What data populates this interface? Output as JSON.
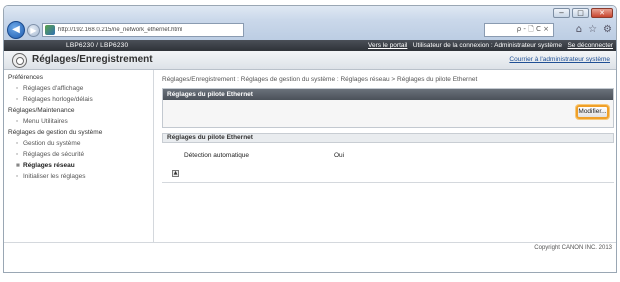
{
  "browser": {
    "url": "http://192.168.0.215/ne_network_ethernet.html",
    "search_hint": "ρ - 🗋 C ×",
    "window_controls": [
      "−",
      "□",
      "✕"
    ]
  },
  "topbar": {
    "model": "LBP6230 / LBP6230",
    "portal_link": "Vers le portail",
    "user_text": "Utilisateur de la connexion : Administrateur système",
    "logout_link": "Se déconnecter"
  },
  "header": {
    "title": "Réglages/Enregistrement",
    "return_link": "Courrier à l'administrateur système"
  },
  "sidebar": {
    "items": [
      {
        "type": "head",
        "label": "Préférences"
      },
      {
        "type": "sub",
        "label": "Réglages d'affichage"
      },
      {
        "type": "sub",
        "label": "Réglages horloge/délais"
      },
      {
        "type": "head",
        "label": "Réglages/Maintenance"
      },
      {
        "type": "sub",
        "label": "Menu Utilitaires"
      },
      {
        "type": "head",
        "label": "Réglages de gestion du système"
      },
      {
        "type": "sub",
        "label": "Gestion du système"
      },
      {
        "type": "sub",
        "label": "Réglages de sécurité"
      },
      {
        "type": "sub-active",
        "label": "Réglages réseau"
      },
      {
        "type": "sub",
        "label": "Initialiser les réglages"
      }
    ]
  },
  "main": {
    "breadcrumb": "Réglages/Enregistrement : Réglages de gestion du système : Réglages réseau > Réglages du pilote Ethernet",
    "panel_title": "Réglages du pilote Ethernet",
    "modify_button": "Modifier...",
    "section_title": "Réglages du pilote Ethernet",
    "rows": [
      {
        "label": "Détection automatique",
        "value": "Oui"
      }
    ],
    "to_top_icon": "arrow-up-icon"
  },
  "footer": {
    "copyright": "Copyright CANON INC. 2013"
  },
  "colors": {
    "highlight": "#f0a028",
    "dark_bar": "#2e3238",
    "link": "#1f4f95"
  }
}
